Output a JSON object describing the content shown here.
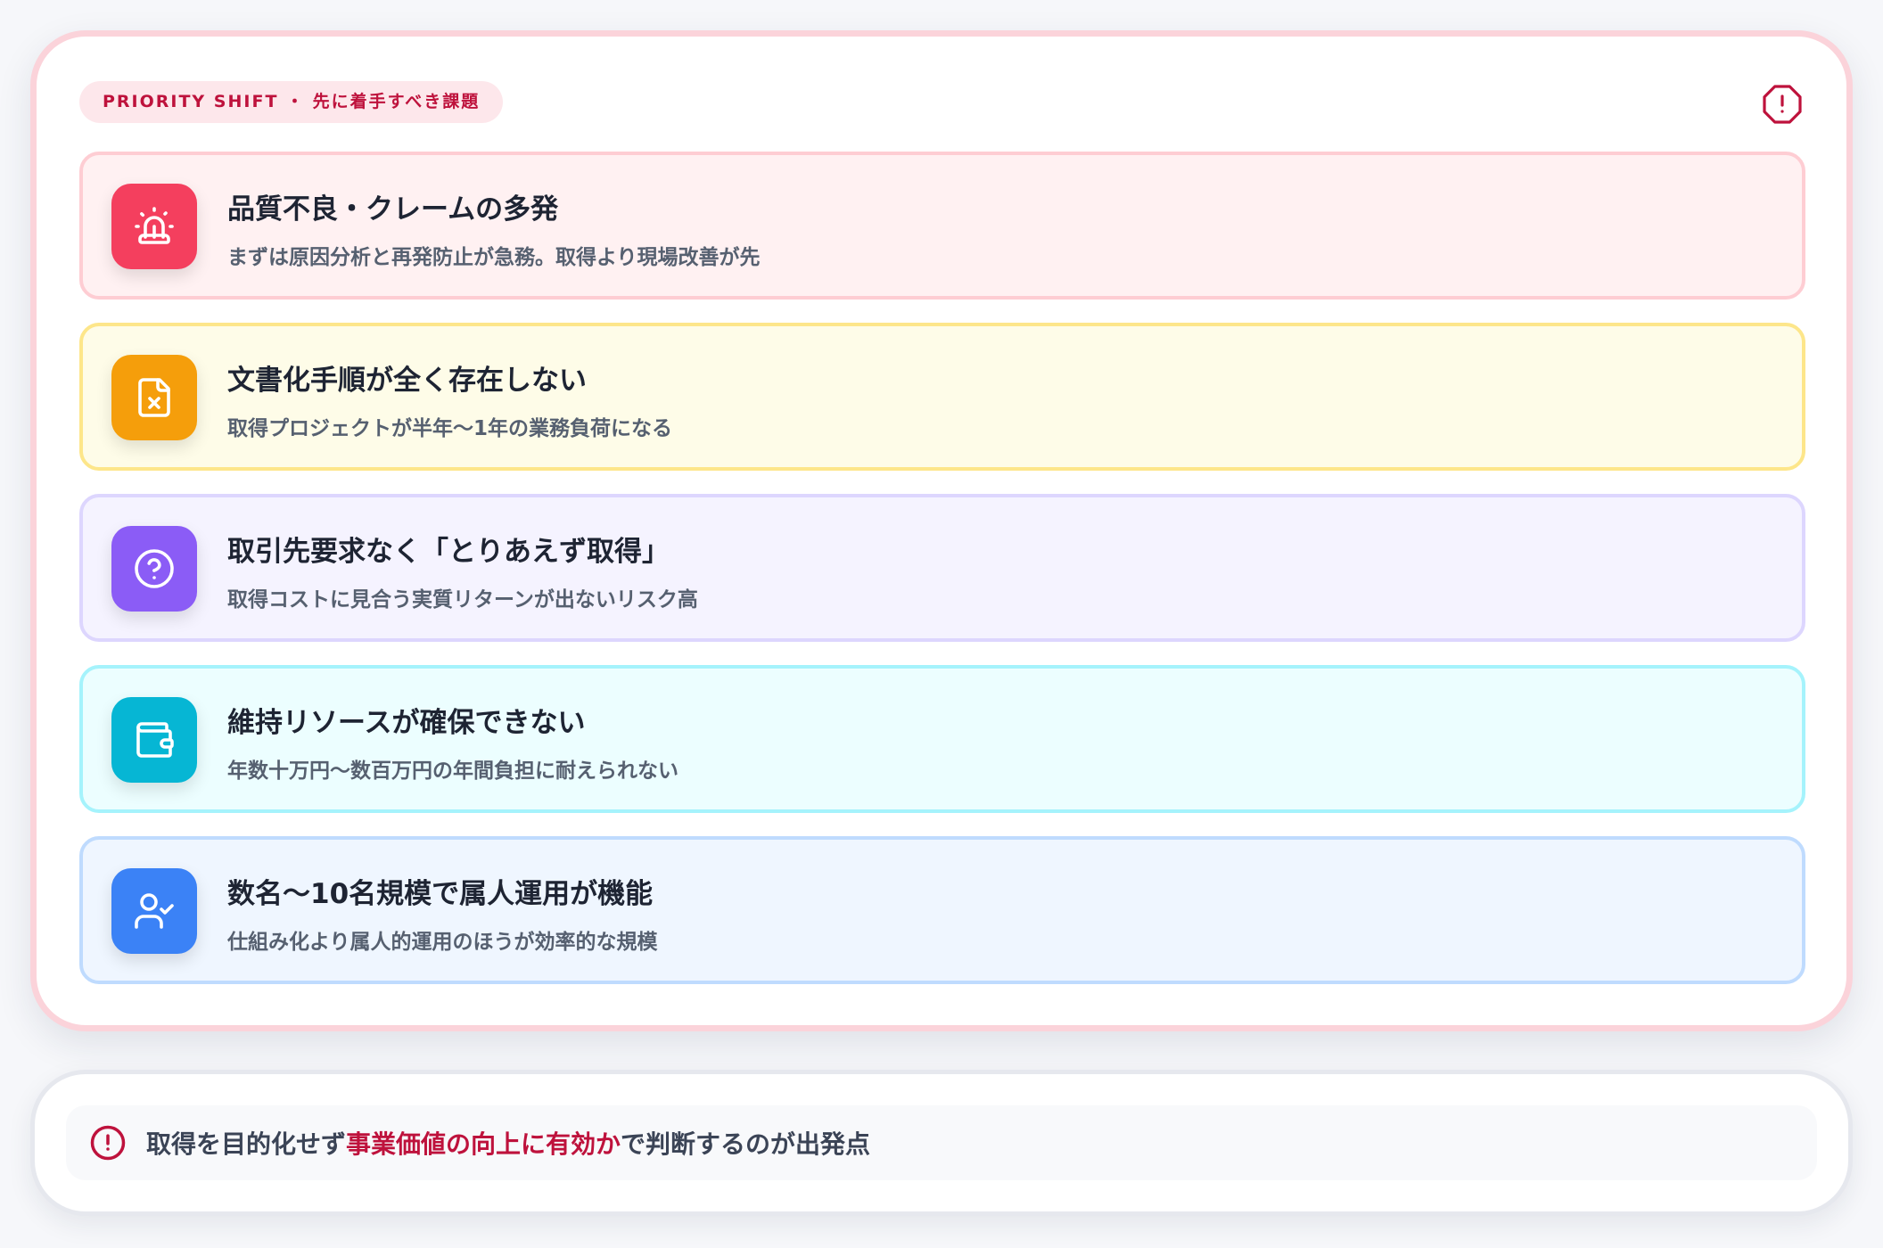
{
  "badge": {
    "label": "PRIORITY SHIFT ・ 先に着手すべき課題"
  },
  "items": [
    {
      "title": "品質不良・クレームの多発",
      "desc": "まずは原因分析と再発防止が急務。取得より現場改善が先",
      "icon": "siren-icon",
      "accent": "#f43f5e",
      "bg": "#fff1f2",
      "border": "#fecdd3"
    },
    {
      "title": "文書化手順が全く存在しない",
      "desc": "取得プロジェクトが半年〜1年の業務負荷になる",
      "icon": "file-x-icon",
      "accent": "#f59e0b",
      "bg": "#fefce8",
      "border": "#fde68a"
    },
    {
      "title": "取引先要求なく「とりあえず取得」",
      "desc": "取得コストに見合う実質リターンが出ないリスク高",
      "icon": "help-circle-icon",
      "accent": "#8b5cf6",
      "bg": "#f5f3ff",
      "border": "#ddd6fe"
    },
    {
      "title": "維持リソースが確保できない",
      "desc": "年数十万円〜数百万円の年間負担に耐えられない",
      "icon": "wallet-icon",
      "accent": "#06b6d4",
      "bg": "#ecfeff",
      "border": "#a5f3fc"
    },
    {
      "title": "数名〜10名規模で属人運用が機能",
      "desc": "仕組み化より属人的運用のほうが効率的な規模",
      "icon": "user-check-icon",
      "accent": "#3b82f6",
      "bg": "#eff6ff",
      "border": "#bfdbfe"
    }
  ],
  "footer": {
    "prefix": "取得を目的化せず",
    "highlight": "事業価値の向上に有効か",
    "suffix": "で判断するのが出発点",
    "icon": "alert-circle-icon",
    "highlight_color": "#be123c"
  },
  "colors": {
    "alert": "#be123c",
    "card_border": "#fbd3da"
  }
}
